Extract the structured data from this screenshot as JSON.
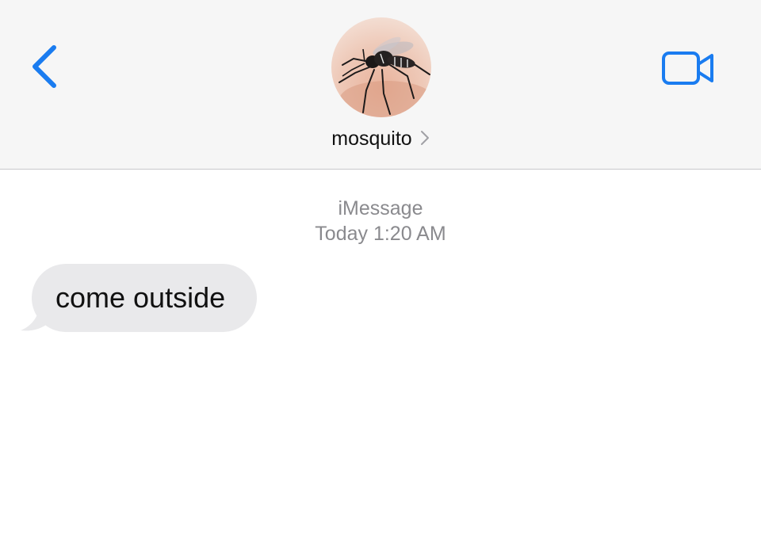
{
  "header": {
    "contact_name": "mosquito",
    "back_icon": "chevron-left-icon",
    "video_icon": "video-camera-icon",
    "disclosure_icon": "chevron-right-icon",
    "accent_color": "#1a7cf0"
  },
  "thread": {
    "service": "iMessage",
    "timestamp": "Today 1:20 AM",
    "messages": [
      {
        "direction": "incoming",
        "text": "come outside"
      }
    ]
  }
}
